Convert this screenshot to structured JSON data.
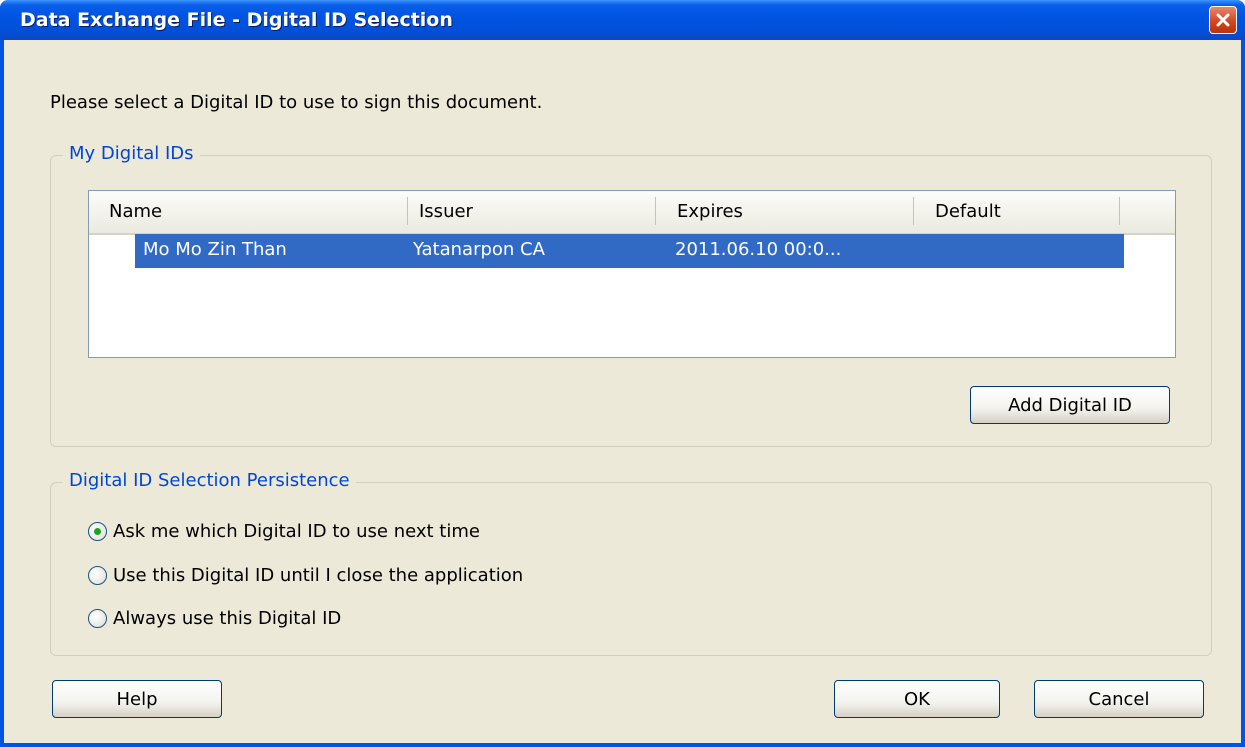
{
  "window": {
    "title": "Data Exchange File - Digital ID Selection"
  },
  "prompt": "Please select a Digital ID to use to sign this document.",
  "my_ids": {
    "legend": "My Digital IDs",
    "columns": [
      "Name",
      "Issuer",
      "Expires",
      "Default"
    ],
    "rows": [
      {
        "name": "Mo Mo Zin Than",
        "issuer": "Yatanarpon CA",
        "expires": "2011.06.10 00:0...",
        "default": ""
      }
    ],
    "add_button": "Add Digital ID"
  },
  "persistence": {
    "legend": "Digital ID Selection Persistence",
    "options": [
      {
        "label": "Ask me which Digital ID to use next time",
        "selected": true
      },
      {
        "label": "Use this Digital ID until I close the application",
        "selected": false
      },
      {
        "label": "Always use this Digital ID",
        "selected": false
      }
    ]
  },
  "buttons": {
    "help": "Help",
    "ok": "OK",
    "cancel": "Cancel"
  },
  "icons": {
    "close": "close-icon",
    "radio_selected": "radio-selected-icon",
    "radio_unselected": "radio-unselected-icon"
  },
  "colors": {
    "titlebar": "#0054e3",
    "selection": "#316ac5",
    "legend_text": "#0046d5",
    "dialog_bg": "#ece9d8"
  }
}
